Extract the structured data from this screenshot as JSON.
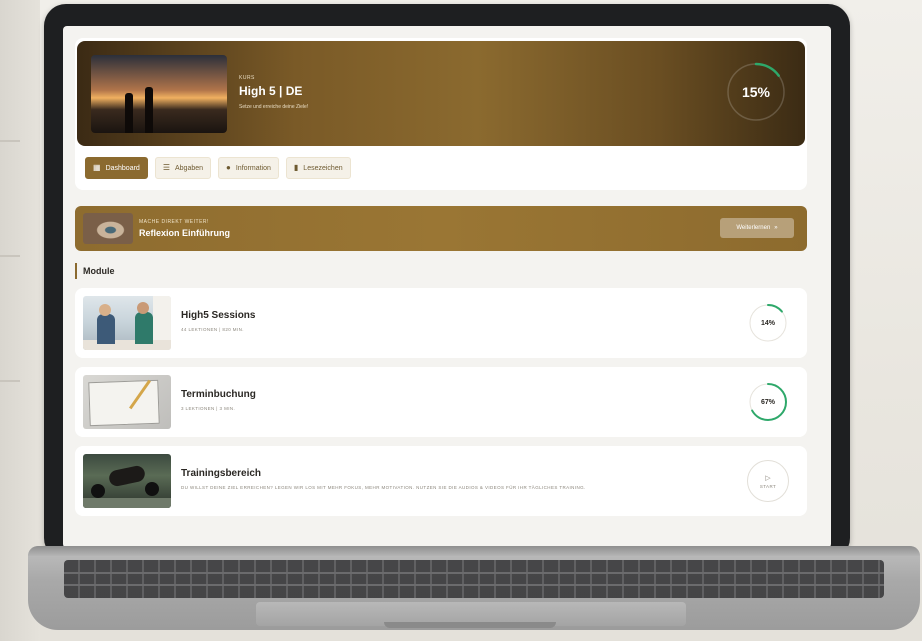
{
  "course": {
    "label": "KURS",
    "title": "High 5 | DE",
    "subtitle": "Setze und erreiche deine Ziele!",
    "progress_text": "15%",
    "progress": 0.15
  },
  "tabs": [
    {
      "label": "Dashboard",
      "icon": "dashboard-icon",
      "active": true
    },
    {
      "label": "Abgaben",
      "icon": "list-icon",
      "active": false
    },
    {
      "label": "Information",
      "icon": "info-icon",
      "active": false
    },
    {
      "label": "Lesezeichen",
      "icon": "bookmark-icon",
      "active": false
    }
  ],
  "continue": {
    "label": "MACHE DIREKT WEITER!",
    "title": "Reflexion Einführung",
    "button_label": "Weiterlernen",
    "button_icon": "double-chevron-right-icon"
  },
  "section": {
    "title": "Module"
  },
  "modules": [
    {
      "title": "High5 Sessions",
      "meta": "44 LEKTIONEN | 820 MIN.",
      "progress_text": "14%",
      "progress": 0.14,
      "thumb": "office-meeting-image"
    },
    {
      "title": "Terminbuchung",
      "meta": "3 LEKTIONEN | 3 MIN.",
      "progress_text": "67%",
      "progress": 0.67,
      "thumb": "notebook-pen-image"
    },
    {
      "title": "Trainingsbereich",
      "meta": "DU WILLST DEINE ZIEL ERREICHEN? LEGEN WIR LOS MIT MEHR FOKUS, MEHR MOTIVATION. NUTZEN SIE DIE AUDIOS & VIDEOS FÜR IHR TÄGLICHES TRAINING.",
      "start_label": "START",
      "start_icon": "play-icon",
      "thumb": "gym-workout-image"
    }
  ],
  "colors": {
    "accent": "#8b6a2f",
    "progress_green": "#2ea86a",
    "card": "#ffffff",
    "screen_bg": "#f4f3f0"
  }
}
